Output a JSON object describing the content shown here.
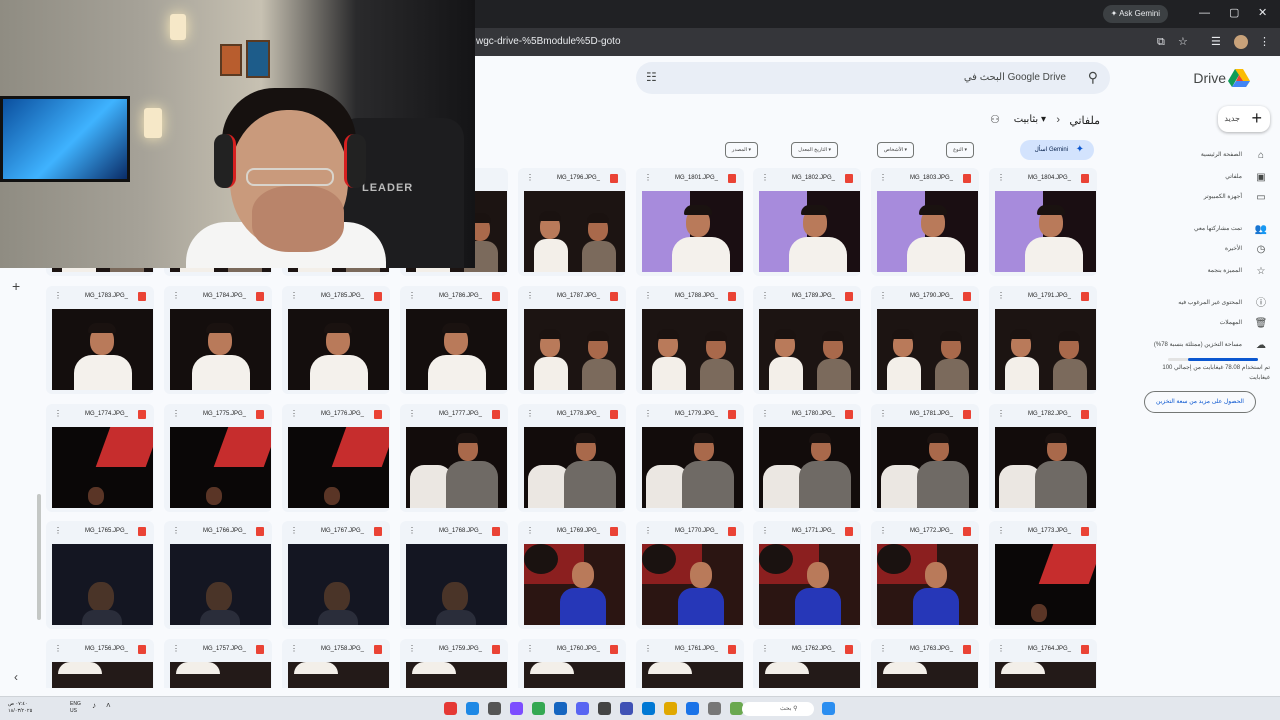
{
  "browser": {
    "ask_gemini": "Ask Gemini",
    "url": "wgc-drive-%5Bmodule%5D-goto",
    "controls": {
      "minimize": "—",
      "maximize": "▢",
      "close": "✕"
    }
  },
  "drive": {
    "logo_text": "Drive",
    "new_label": "جديد",
    "search_placeholder": "البحث في Google Drive",
    "breadcrumb": {
      "root": "ملفاتي",
      "current": "بثابيت"
    },
    "filters": [
      "النوع",
      "الأشخاص",
      "التاريخ المعدل",
      "المصدر"
    ],
    "gemini_chip": "اسأل Gemini",
    "nav": [
      {
        "label": "الصفحة الرئيسية",
        "icon": "home-icon",
        "glyph": "⌂"
      },
      {
        "label": "ملفاتي",
        "icon": "drive-icon",
        "glyph": "▣"
      },
      {
        "label": "أجهزة الكمبيوتر",
        "icon": "computer-icon",
        "glyph": "▭"
      },
      {
        "label": "تمت مشاركتها معي",
        "icon": "people-icon",
        "glyph": "👥"
      },
      {
        "label": "الأخيرة",
        "icon": "clock-icon",
        "glyph": "◷"
      },
      {
        "label": "المميزة بنجمة",
        "icon": "star-icon",
        "glyph": "☆"
      },
      {
        "label": "المحتوى غير المرغوب فيه",
        "icon": "spam-icon",
        "glyph": "ⓘ"
      },
      {
        "label": "المهملات",
        "icon": "trash-icon",
        "glyph": "🗑"
      },
      {
        "label": "مساحة التخزين (ممتلئة بنسبة 78%)",
        "icon": "cloud-icon",
        "glyph": "☁"
      }
    ],
    "storage": {
      "used_fraction": 0.78,
      "text": "تم استخدام 78.08 غيغابايت من إجمالي 100 غيغابايت",
      "button": "الحصول على مزيد من سعة التخزين"
    },
    "rows": [
      {
        "files": [
          "",
          "",
          "",
          "",
          "",
          "",
          "",
          "",
          ""
        ],
        "scene": "cut"
      },
      {
        "files": [
          "",
          "",
          "",
          "",
          "MG_1796.JPG_",
          "MG_1801.JPG_",
          "MG_1802.JPG_",
          "MG_1803.JPG_",
          "MG_1804.JPG_"
        ],
        "scene": "duo"
      },
      {
        "files": [
          "MG_1783.JPG_",
          "MG_1784.JPG_",
          "MG_1785.JPG_",
          "MG_1786.JPG_",
          "MG_1787.JPG_",
          "MG_1788.JPG_",
          "MG_1789.JPG_",
          "MG_1790.JPG_",
          "MG_1791.JPG_"
        ],
        "scene": "mixed1"
      },
      {
        "files": [
          "MG_1774.JPG_",
          "MG_1775.JPG_",
          "MG_1776.JPG_",
          "MG_1777.JPG_",
          "MG_1778.JPG_",
          "MG_1779.JPG_",
          "MG_1780.JPG_",
          "MG_1781.JPG_",
          "MG_1782.JPG_"
        ],
        "scene": "mixed2"
      },
      {
        "files": [
          "MG_1765.JPG_",
          "MG_1766.JPG_",
          "MG_1767.JPG_",
          "MG_1768.JPG_",
          "MG_1769.JPG_",
          "MG_1770.JPG_",
          "MG_1771.JPG_",
          "MG_1772.JPG_",
          "MG_1773.JPG_"
        ],
        "scene": "mixed3"
      },
      {
        "files": [
          "MG_1756.JPG_",
          "MG_1757.JPG_",
          "MG_1758.JPG_",
          "MG_1759.JPG_",
          "MG_1760.JPG_",
          "MG_1761.JPG_",
          "MG_1762.JPG_",
          "MG_1763.JPG_",
          "MG_1764.JPG_"
        ],
        "scene": "cut"
      }
    ]
  },
  "webcam": {
    "chair_brand": "LEADER"
  },
  "taskbar": {
    "time": "٠٧:٤٠ ص",
    "date": "١٨/٠٣/٢٠٢٥",
    "lang": "ENG",
    "region": "US",
    "search_label": "بحث"
  }
}
